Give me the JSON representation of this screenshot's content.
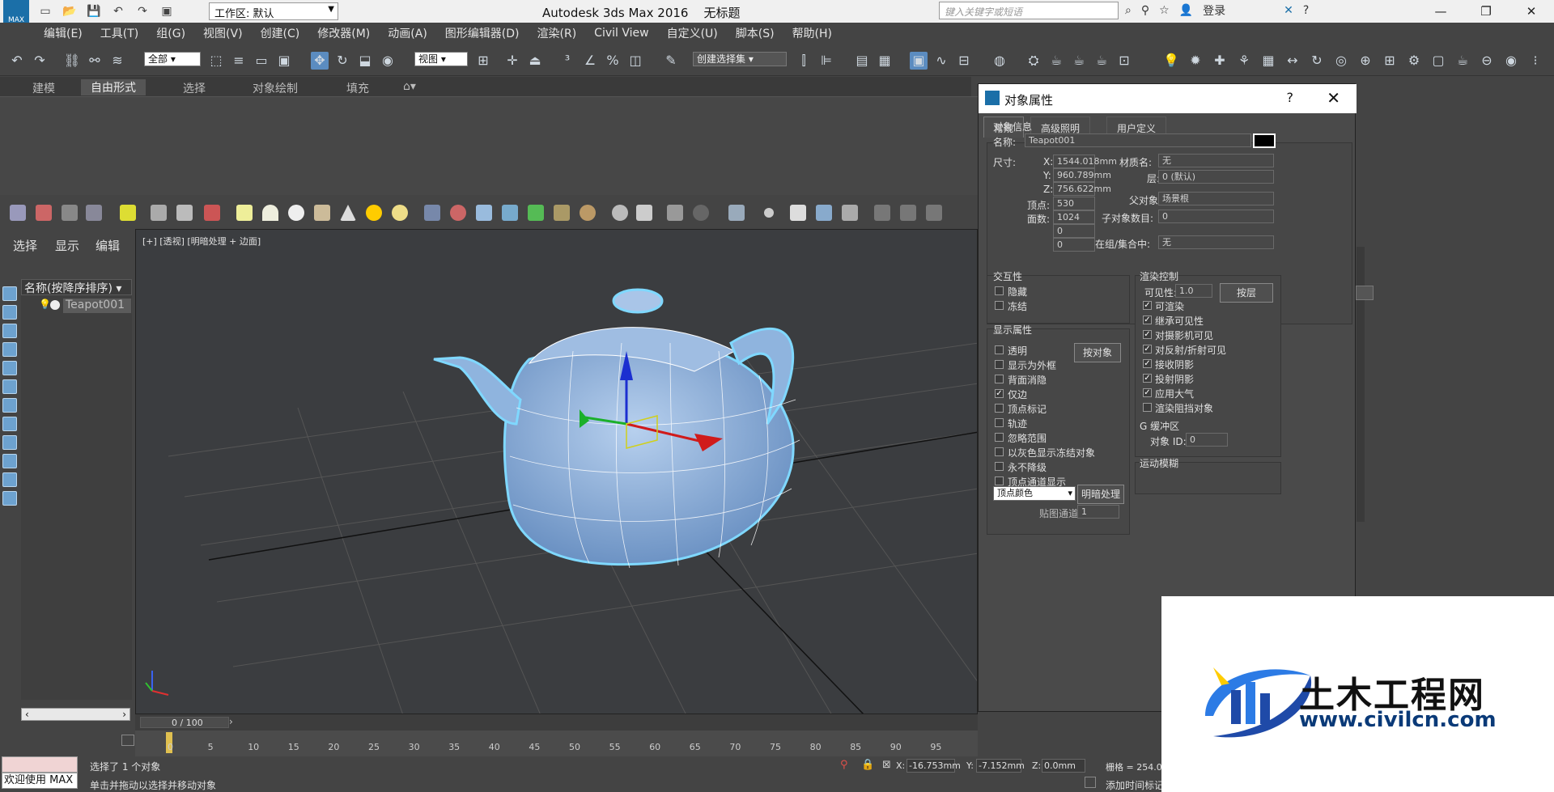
{
  "app": {
    "title": "Autodesk 3ds Max 2016",
    "doc_title": "无标题",
    "logo_text": "MAX",
    "workspace_label": "工作区: 默认",
    "search_placeholder": "键入关键字或短语",
    "login": "登录"
  },
  "menu": [
    "编辑(E)",
    "工具(T)",
    "组(G)",
    "视图(V)",
    "创建(C)",
    "修改器(M)",
    "动画(A)",
    "图形编辑器(D)",
    "渲染(R)",
    "Civil View",
    "自定义(U)",
    "脚本(S)",
    "帮助(H)"
  ],
  "toolbar": {
    "filter_select": "全部",
    "ref_coord_select": "视图",
    "selection_set": "创建选择集"
  },
  "ribbon_tabs": [
    "建模",
    "自由形式",
    "选择",
    "对象绘制",
    "填充"
  ],
  "left_panel": {
    "tabs": [
      "选择",
      "显示",
      "编辑"
    ],
    "list_header": "名称(按降序排序)",
    "item": "Teapot001"
  },
  "viewport": {
    "label": "[+] [透视] [明暗处理 + 边面]"
  },
  "dialog": {
    "title": "对象属性",
    "tabs": [
      "常规",
      "高级照明",
      "用户定义"
    ],
    "object_info": {
      "title": "对象信息",
      "name_label": "名称:",
      "name_value": "Teapot001",
      "dims_label": "尺寸:",
      "x_label": "X:",
      "x_value": "1544.018mm",
      "y_label": "Y:",
      "y_value": "960.789mm",
      "z_label": "Z:",
      "z_value": "756.622mm",
      "verts_label": "顶点:",
      "verts_value": "530",
      "faces_label": "面数:",
      "faces_value": "1024",
      "extra1": "0",
      "extra2": "0",
      "material_label": "材质名:",
      "material_value": "无",
      "layer_label": "层:",
      "layer_value": "0 (默认)",
      "parent_label": "父对象:",
      "parent_value": "场景根",
      "children_label": "子对象数目:",
      "children_value": "0",
      "group_label": "在组/集合中:",
      "group_value": "无"
    },
    "interactivity": {
      "title": "交互性",
      "hide": "隐藏",
      "freeze": "冻结"
    },
    "display_props": {
      "title": "显示属性",
      "by_object_btn": "按对象",
      "items": [
        {
          "label": "透明",
          "checked": false
        },
        {
          "label": "显示为外框",
          "checked": false
        },
        {
          "label": "背面消隐",
          "checked": false
        },
        {
          "label": "仅边",
          "checked": true
        },
        {
          "label": "顶点标记",
          "checked": false
        },
        {
          "label": "轨迹",
          "checked": false
        },
        {
          "label": "忽略范围",
          "checked": false
        },
        {
          "label": "以灰色显示冻结对象",
          "checked": false
        },
        {
          "label": "永不降级",
          "checked": false
        },
        {
          "label": "顶点通道显示",
          "checked": false
        }
      ],
      "vertex_color_select": "顶点颜色",
      "shaded_btn": "明暗处理",
      "map_channel_label": "贴图通道:",
      "map_channel_value": "1"
    },
    "render_control": {
      "title": "渲染控制",
      "visibility_label": "可见性:",
      "visibility_value": "1.0",
      "by_layer_btn": "按层",
      "items": [
        {
          "label": "可渲染",
          "checked": true
        },
        {
          "label": "继承可见性",
          "checked": true
        },
        {
          "label": "对摄影机可见",
          "checked": true
        },
        {
          "label": "对反射/折射可见",
          "checked": true
        },
        {
          "label": "接收阴影",
          "checked": true
        },
        {
          "label": "投射阴影",
          "checked": true
        },
        {
          "label": "应用大气",
          "checked": true
        },
        {
          "label": "渲染阻挡对象",
          "checked": false
        }
      ],
      "gbuffer_title": "G 缓冲区",
      "object_id_label": "对象 ID:",
      "object_id_value": "0",
      "motion_blur_title": "运动模糊"
    }
  },
  "timeline": {
    "frame_label": "0 / 100",
    "ticks": [
      "0",
      "5",
      "10",
      "15",
      "20",
      "25",
      "30",
      "35",
      "40",
      "45",
      "50",
      "55",
      "60",
      "65",
      "70",
      "75",
      "80",
      "85",
      "90",
      "95"
    ]
  },
  "status": {
    "welcome": "欢迎使用 MAX",
    "selected": "选择了 1 个对象",
    "hint": "单击并拖动以选择并移动对象",
    "x_label": "X:",
    "x_value": "-16.753mm",
    "y_label": "Y:",
    "y_value": "-7.152mm",
    "z_label": "Z:",
    "z_value": "0.0mm",
    "grid": "栅格 = 254.0",
    "add_time_tag": "添加时间标记"
  },
  "watermark": {
    "title": "土木工程网",
    "url": "www.civilcn.com"
  },
  "colors": {
    "teapot": "#8fb4de",
    "selection_outline": "#7fd8ff"
  }
}
